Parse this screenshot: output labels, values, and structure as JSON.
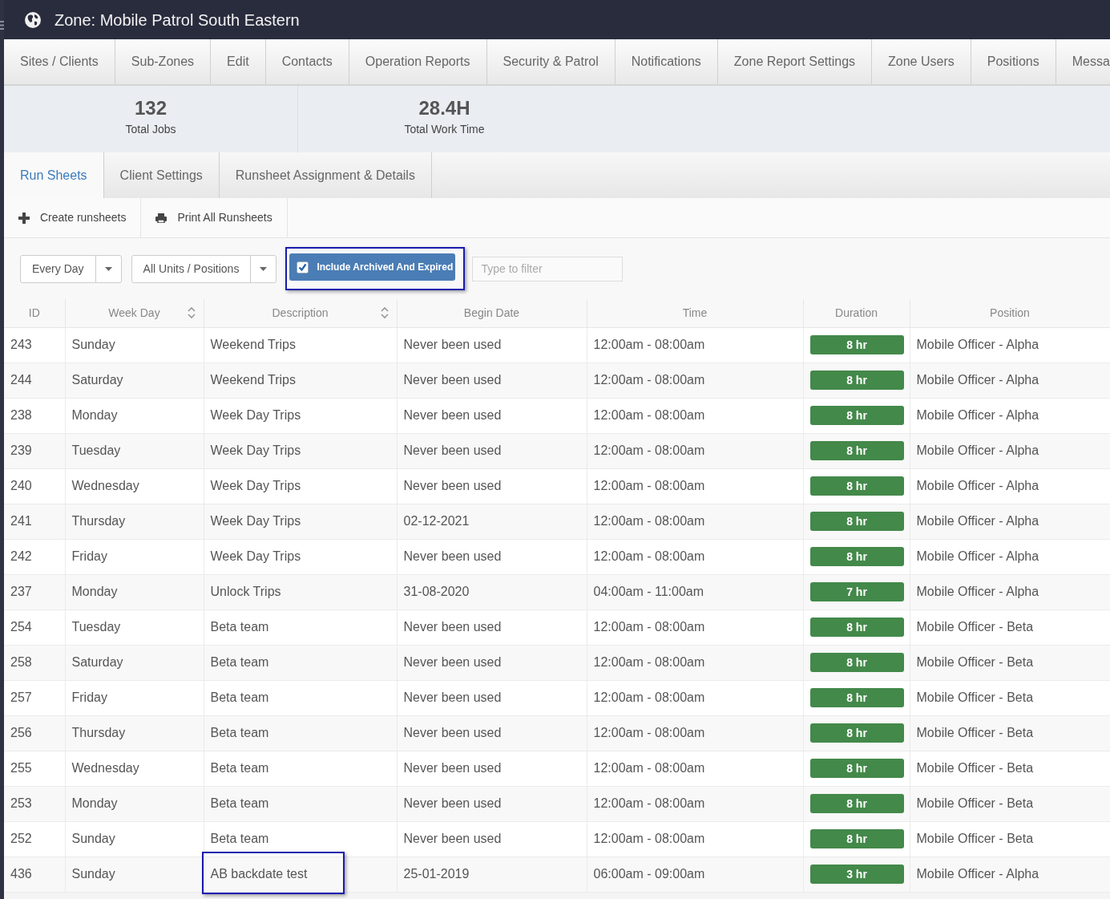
{
  "window": {
    "title": "Zone: Mobile Patrol South Eastern"
  },
  "main_tabs": [
    {
      "label": "Sites / Clients",
      "selected": false
    },
    {
      "label": "Sub-Zones",
      "selected": false
    },
    {
      "label": "Edit",
      "selected": false
    },
    {
      "label": "Contacts",
      "selected": false
    },
    {
      "label": "Operation Reports",
      "selected": false
    },
    {
      "label": "Security & Patrol",
      "selected": false
    },
    {
      "label": "Notifications",
      "selected": false
    },
    {
      "label": "Zone Report Settings",
      "selected": false
    },
    {
      "label": "Zone Users",
      "selected": false
    },
    {
      "label": "Positions",
      "selected": false
    },
    {
      "label": "Messa",
      "selected": false
    }
  ],
  "stats": [
    {
      "value": "132",
      "label": "Total Jobs"
    },
    {
      "value": "28.4H",
      "label": "Total Work Time"
    }
  ],
  "sub_tabs": [
    {
      "label": "Run Sheets",
      "selected": true
    },
    {
      "label": "Client Settings",
      "selected": false
    },
    {
      "label": "Runsheet Assignment & Details",
      "selected": false
    }
  ],
  "toolbar": [
    {
      "kind": "create",
      "label": "Create runsheets"
    },
    {
      "kind": "print",
      "label": "Print All Runsheets"
    }
  ],
  "filters": {
    "day_select": {
      "value": "Every Day"
    },
    "unit_select": {
      "value": "All Units / Positions"
    },
    "archived_toggle": {
      "label": "Include Archived And Expired",
      "checked": true,
      "highlighted": true
    },
    "search": {
      "placeholder": "Type to filter"
    }
  },
  "table": {
    "columns": [
      {
        "label": "ID",
        "sortable": false
      },
      {
        "label": "Week Day",
        "sortable": true
      },
      {
        "label": "Description",
        "sortable": true
      },
      {
        "label": "Begin Date",
        "sortable": false
      },
      {
        "label": "Time",
        "sortable": false
      },
      {
        "label": "Duration",
        "sortable": false
      },
      {
        "label": "Position",
        "sortable": false
      }
    ],
    "rows": [
      {
        "id": "243",
        "week_day": "Sunday",
        "description": "Weekend Trips",
        "begin_date": "Never been used",
        "time": "12:00am - 08:00am",
        "duration": "8 hr",
        "position": "Mobile Officer - Alpha",
        "description_highlighted": false
      },
      {
        "id": "244",
        "week_day": "Saturday",
        "description": "Weekend Trips",
        "begin_date": "Never been used",
        "time": "12:00am - 08:00am",
        "duration": "8 hr",
        "position": "Mobile Officer - Alpha",
        "description_highlighted": false
      },
      {
        "id": "238",
        "week_day": "Monday",
        "description": "Week Day Trips",
        "begin_date": "Never been used",
        "time": "12:00am - 08:00am",
        "duration": "8 hr",
        "position": "Mobile Officer - Alpha",
        "description_highlighted": false
      },
      {
        "id": "239",
        "week_day": "Tuesday",
        "description": "Week Day Trips",
        "begin_date": "Never been used",
        "time": "12:00am - 08:00am",
        "duration": "8 hr",
        "position": "Mobile Officer - Alpha",
        "description_highlighted": false
      },
      {
        "id": "240",
        "week_day": "Wednesday",
        "description": "Week Day Trips",
        "begin_date": "Never been used",
        "time": "12:00am - 08:00am",
        "duration": "8 hr",
        "position": "Mobile Officer - Alpha",
        "description_highlighted": false
      },
      {
        "id": "241",
        "week_day": "Thursday",
        "description": "Week Day Trips",
        "begin_date": "02-12-2021",
        "time": "12:00am - 08:00am",
        "duration": "8 hr",
        "position": "Mobile Officer - Alpha",
        "description_highlighted": false
      },
      {
        "id": "242",
        "week_day": "Friday",
        "description": "Week Day Trips",
        "begin_date": "Never been used",
        "time": "12:00am - 08:00am",
        "duration": "8 hr",
        "position": "Mobile Officer - Alpha",
        "description_highlighted": false
      },
      {
        "id": "237",
        "week_day": "Monday",
        "description": "Unlock Trips",
        "begin_date": "31-08-2020",
        "time": "04:00am - 11:00am",
        "duration": "7 hr",
        "position": "Mobile Officer - Alpha",
        "description_highlighted": false
      },
      {
        "id": "254",
        "week_day": "Tuesday",
        "description": "Beta team",
        "begin_date": "Never been used",
        "time": "12:00am - 08:00am",
        "duration": "8 hr",
        "position": "Mobile Officer - Beta",
        "description_highlighted": false
      },
      {
        "id": "258",
        "week_day": "Saturday",
        "description": "Beta team",
        "begin_date": "Never been used",
        "time": "12:00am - 08:00am",
        "duration": "8 hr",
        "position": "Mobile Officer - Beta",
        "description_highlighted": false
      },
      {
        "id": "257",
        "week_day": "Friday",
        "description": "Beta team",
        "begin_date": "Never been used",
        "time": "12:00am - 08:00am",
        "duration": "8 hr",
        "position": "Mobile Officer - Beta",
        "description_highlighted": false
      },
      {
        "id": "256",
        "week_day": "Thursday",
        "description": "Beta team",
        "begin_date": "Never been used",
        "time": "12:00am - 08:00am",
        "duration": "8 hr",
        "position": "Mobile Officer - Beta",
        "description_highlighted": false
      },
      {
        "id": "255",
        "week_day": "Wednesday",
        "description": "Beta team",
        "begin_date": "Never been used",
        "time": "12:00am - 08:00am",
        "duration": "8 hr",
        "position": "Mobile Officer - Beta",
        "description_highlighted": false
      },
      {
        "id": "253",
        "week_day": "Monday",
        "description": "Beta team",
        "begin_date": "Never been used",
        "time": "12:00am - 08:00am",
        "duration": "8 hr",
        "position": "Mobile Officer - Beta",
        "description_highlighted": false
      },
      {
        "id": "252",
        "week_day": "Sunday",
        "description": "Beta team",
        "begin_date": "Never been used",
        "time": "12:00am - 08:00am",
        "duration": "8 hr",
        "position": "Mobile Officer - Beta",
        "description_highlighted": false
      },
      {
        "id": "436",
        "week_day": "Sunday",
        "description": "AB backdate test",
        "begin_date": "25-01-2019",
        "time": "06:00am - 09:00am",
        "duration": "3 hr",
        "position": "Mobile Officer - Alpha",
        "description_highlighted": true
      }
    ]
  }
}
